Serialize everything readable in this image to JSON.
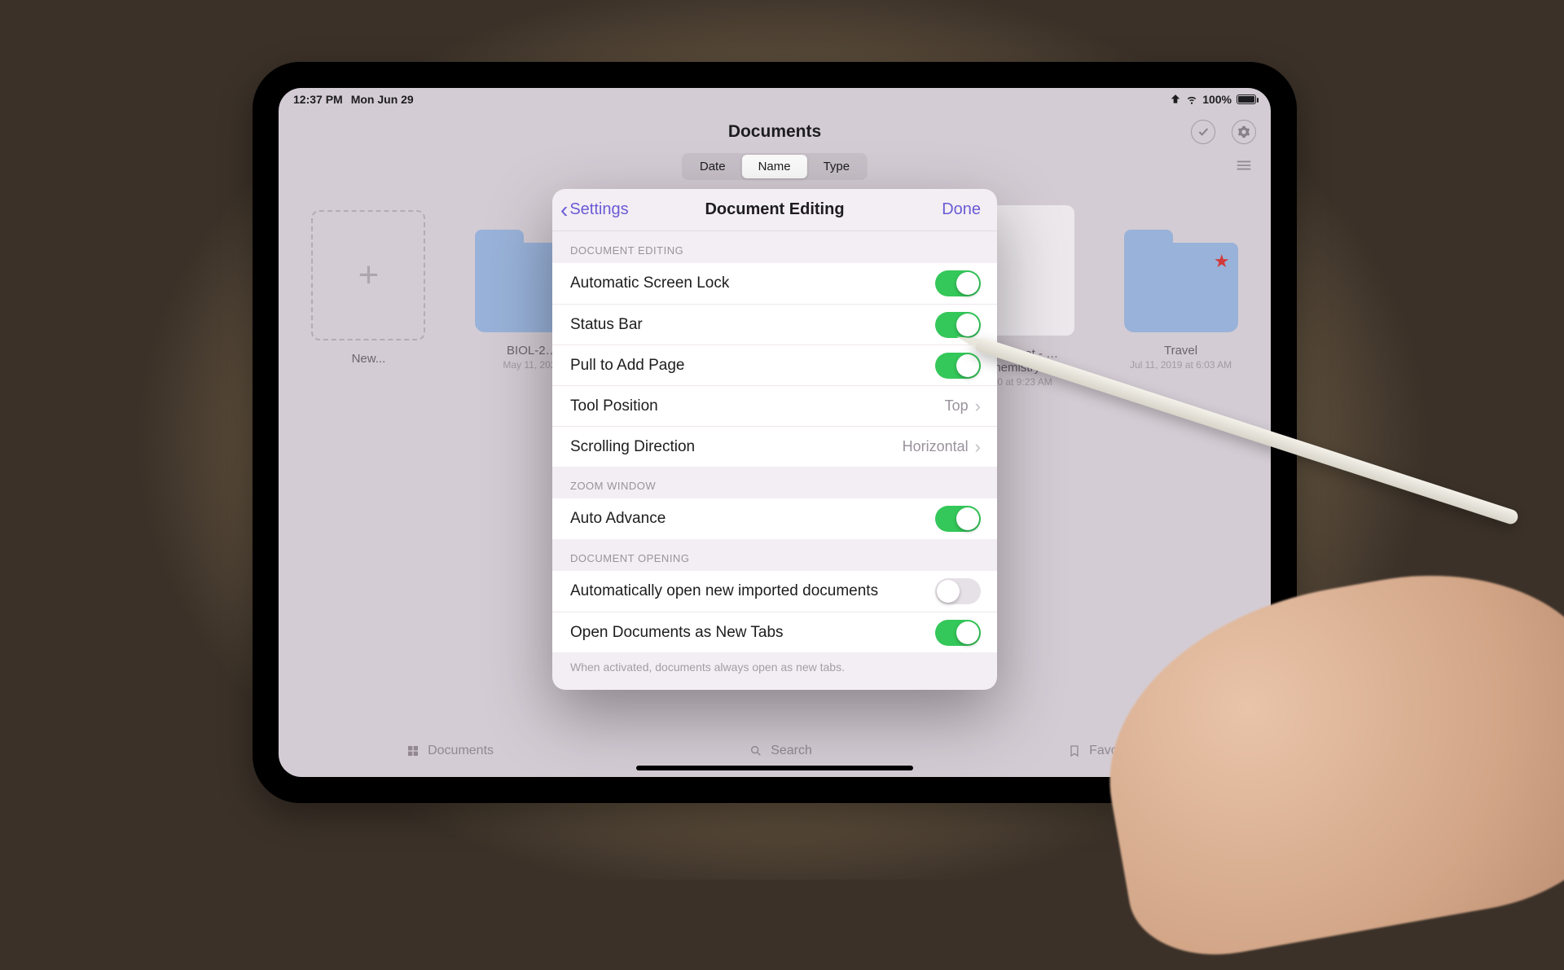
{
  "statusbar": {
    "time": "12:37 PM",
    "date": "Mon Jun 29",
    "battery": "100%"
  },
  "nav": {
    "title": "Documents"
  },
  "segmented": {
    "items": [
      "Date",
      "Name",
      "Type"
    ],
    "selected_index": 1
  },
  "documents": [
    {
      "label": "New...",
      "sub": "",
      "kind": "new"
    },
    {
      "label": "BIOL-2…",
      "sub": "May 11, 2020",
      "kind": "folder"
    },
    {
      "label": "…orksheet - …hemistry",
      "sub": "…20 at 9:23 AM",
      "kind": "doc"
    },
    {
      "label": "Travel",
      "sub": "Jul 11, 2019 at 6:03 AM",
      "kind": "folder_starred"
    }
  ],
  "modal": {
    "back_label": "Settings",
    "title": "Document Editing",
    "done_label": "Done",
    "footnote": "When activated, documents always open as new tabs.",
    "sections": [
      {
        "header": "DOCUMENT EDITING",
        "rows": [
          {
            "key": "auto_screen_lock",
            "label": "Automatic Screen Lock",
            "type": "switch",
            "on": true
          },
          {
            "key": "status_bar",
            "label": "Status Bar",
            "type": "switch",
            "on": true
          },
          {
            "key": "pull_add_page",
            "label": "Pull to Add Page",
            "type": "switch",
            "on": true
          },
          {
            "key": "tool_position",
            "label": "Tool Position",
            "type": "nav",
            "value": "Top"
          },
          {
            "key": "scroll_direction",
            "label": "Scrolling Direction",
            "type": "nav",
            "value": "Horizontal"
          }
        ]
      },
      {
        "header": "ZOOM WINDOW",
        "rows": [
          {
            "key": "auto_advance",
            "label": "Auto Advance",
            "type": "switch",
            "on": true
          }
        ]
      },
      {
        "header": "DOCUMENT OPENING",
        "rows": [
          {
            "key": "auto_open_imports",
            "label": "Automatically open new imported documents",
            "type": "switch",
            "on": false
          },
          {
            "key": "open_as_tabs",
            "label": "Open Documents as New Tabs",
            "type": "switch",
            "on": true
          }
        ]
      }
    ]
  },
  "tabbar": {
    "documents": "Documents",
    "search": "Search",
    "favorites": "Favorites"
  }
}
